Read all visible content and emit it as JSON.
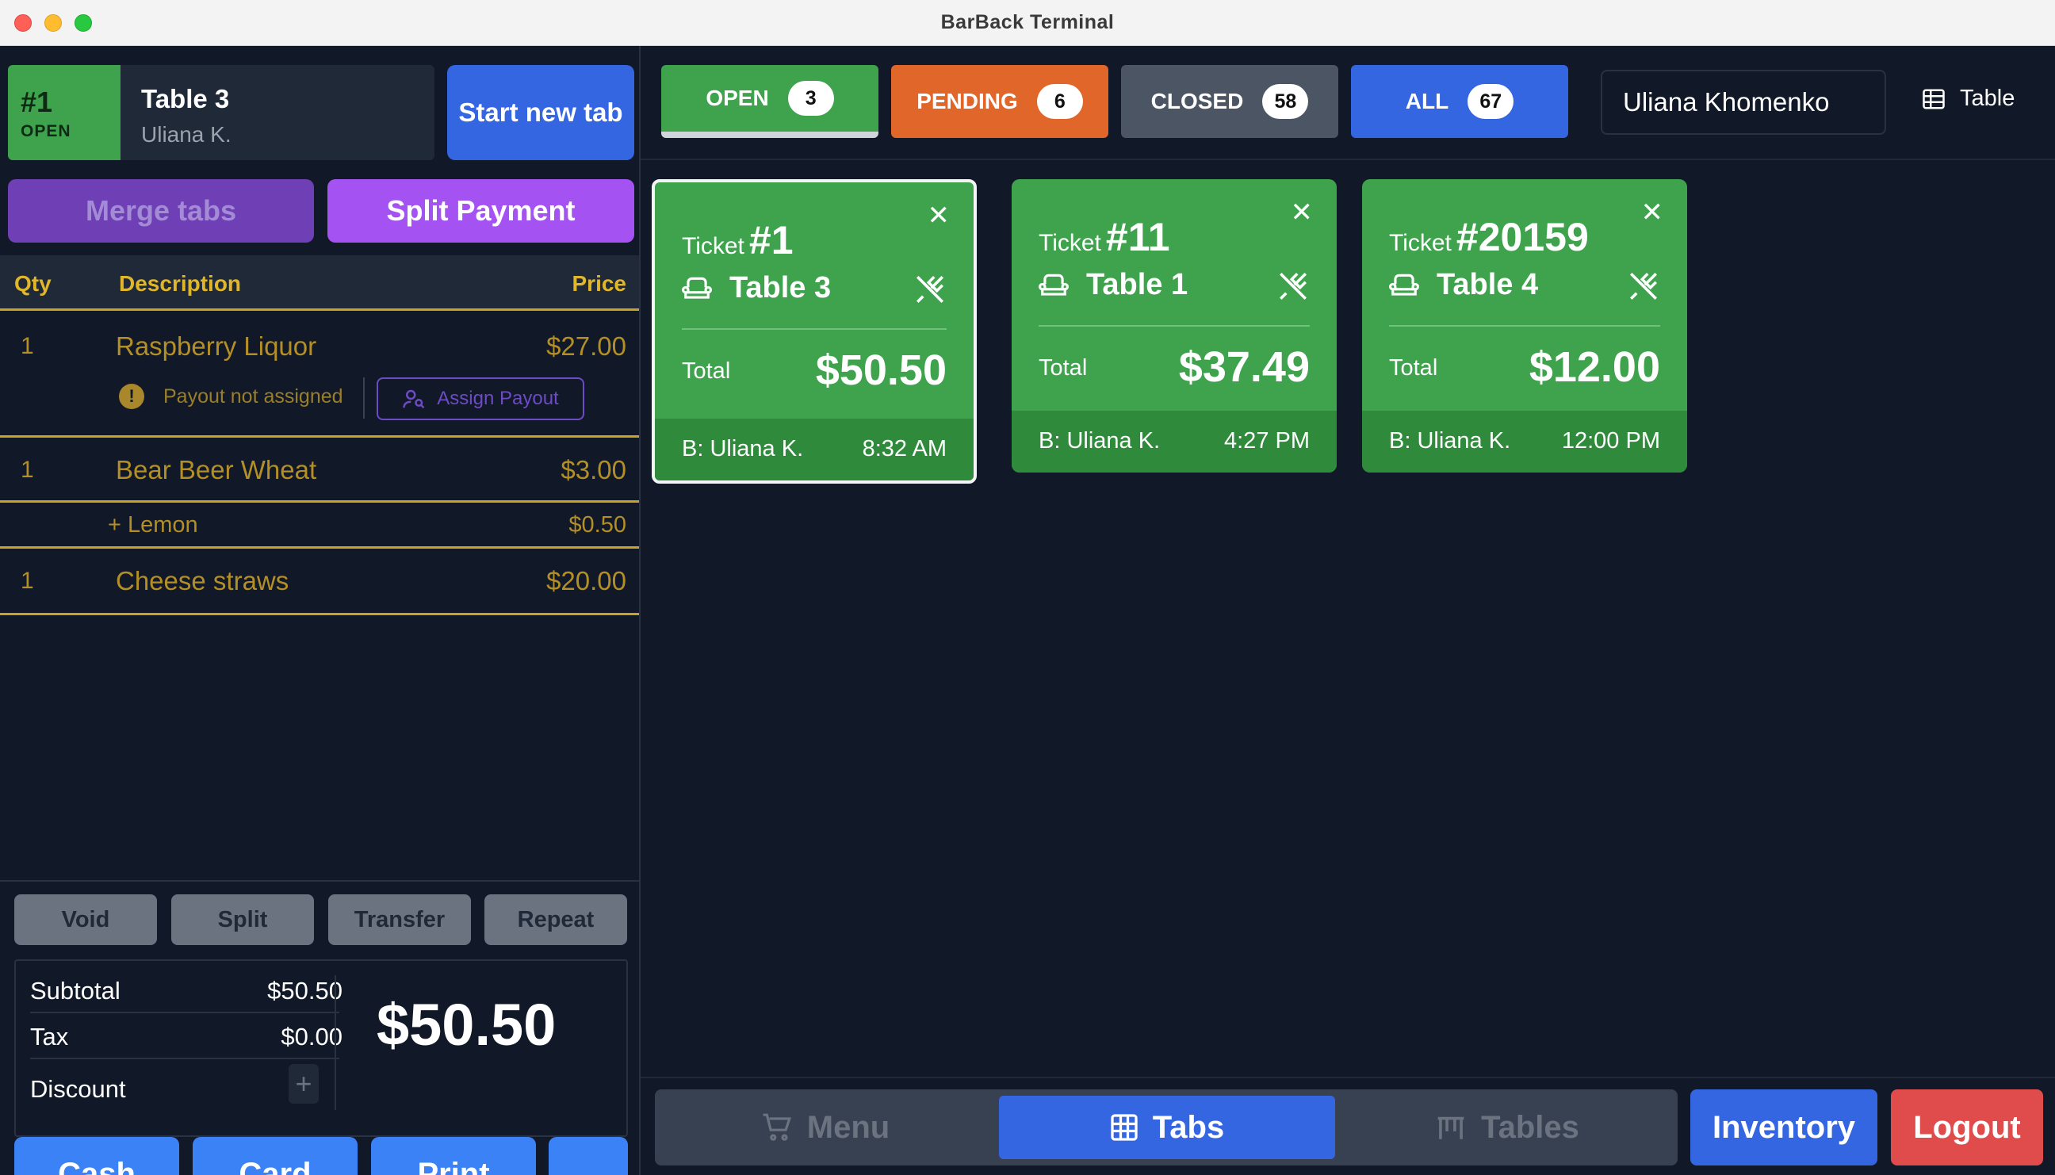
{
  "window": {
    "title": "BarBack Terminal"
  },
  "current_tab": {
    "number": "#1",
    "status": "OPEN",
    "table": "Table 3",
    "user": "Uliana K."
  },
  "left_actions": {
    "start_new_tab": "Start new tab",
    "merge_tabs": "Merge tabs",
    "split_payment": "Split Payment"
  },
  "order": {
    "columns": {
      "qty": "Qty",
      "description": "Description",
      "price": "Price"
    },
    "items": [
      {
        "qty": "1",
        "description": "Raspberry Liquor",
        "price": "$27.00",
        "warning": "Payout not assigned",
        "assign_label": "Assign Payout"
      },
      {
        "qty": "1",
        "description": "Bear Beer Wheat",
        "price": "$3.00",
        "modifier": {
          "description": "+ Lemon",
          "price": "$0.50"
        }
      },
      {
        "qty": "1",
        "description": "Cheese straws",
        "price": "$20.00"
      }
    ]
  },
  "item_actions": {
    "void": "Void",
    "split": "Split",
    "transfer": "Transfer",
    "repeat": "Repeat"
  },
  "totals": {
    "subtotal_label": "Subtotal",
    "subtotal": "$50.50",
    "tax_label": "Tax",
    "tax": "$0.00",
    "discount_label": "Discount",
    "discount_add": "+",
    "grand_total": "$50.50"
  },
  "payment": {
    "cash": "Cash",
    "card": "Card",
    "print": "Print",
    "more": "..."
  },
  "filters": [
    {
      "label": "OPEN",
      "count": "3",
      "color": "#3fa34d"
    },
    {
      "label": "PENDING",
      "count": "6",
      "color": "#e0662a"
    },
    {
      "label": "CLOSED",
      "count": "58",
      "color": "#4b5563"
    },
    {
      "label": "ALL",
      "count": "67",
      "color": "#3566e2"
    }
  ],
  "user_field": {
    "value": "Uliana Khomenko"
  },
  "view_toggle": {
    "label": "Table",
    "icon": "table-grid-icon"
  },
  "tickets": [
    {
      "prefix": "Ticket",
      "number": "#1",
      "table": "Table 3",
      "total_label": "Total",
      "total": "$50.50",
      "by": "B: Uliana K.",
      "time": "8:32 AM",
      "selected": true
    },
    {
      "prefix": "Ticket",
      "number": "#11",
      "table": "Table 1",
      "total_label": "Total",
      "total": "$37.49",
      "by": "B: Uliana K.",
      "time": "4:27 PM",
      "selected": false
    },
    {
      "prefix": "Ticket",
      "number": "#20159",
      "table": "Table 4",
      "total_label": "Total",
      "total": "$12.00",
      "by": "B: Uliana K.",
      "time": "12:00 PM",
      "selected": false
    }
  ],
  "nav": {
    "menu": "Menu",
    "tabs": "Tabs",
    "tables": "Tables",
    "inventory": "Inventory",
    "logout": "Logout"
  },
  "colors": {
    "accent_blue": "#3566e2",
    "open_green": "#3fa34d",
    "pending_orange": "#e0662a",
    "logout_red": "#e04b4b",
    "split_purple": "#a452f2"
  }
}
